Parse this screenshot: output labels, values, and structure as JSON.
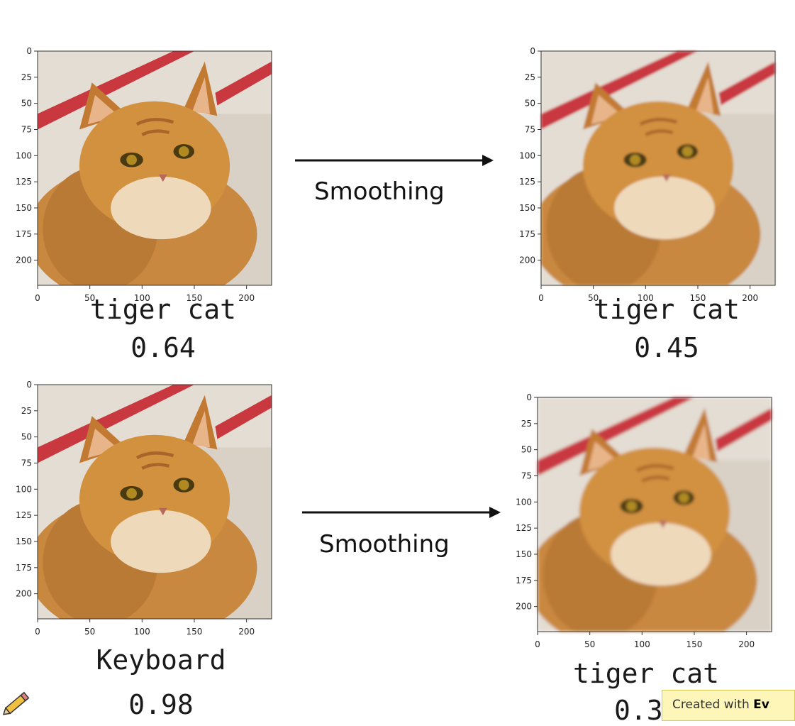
{
  "panels": [
    {
      "id": "top-left",
      "label": "tiger cat",
      "score": "0.64"
    },
    {
      "id": "top-right",
      "label": "tiger cat",
      "score": "0.45"
    },
    {
      "id": "bottom-left",
      "label": "Keyboard",
      "score": "0.98"
    },
    {
      "id": "bottom-right",
      "label": "tiger cat",
      "score": "0.3"
    }
  ],
  "arrows": [
    {
      "label": "Smoothing"
    },
    {
      "label": "Smoothing"
    }
  ],
  "axis": {
    "y_ticks": [
      0,
      25,
      50,
      75,
      100,
      125,
      150,
      175,
      200
    ],
    "x_ticks": [
      0,
      50,
      100,
      150,
      200
    ],
    "range": [
      0,
      224
    ]
  },
  "watermark": {
    "prefix": "Created with ",
    "brand": "Ev"
  },
  "colors": {
    "fur": "#d08a3c",
    "stripe": "#c9383f",
    "background": "#e6dfd4"
  }
}
